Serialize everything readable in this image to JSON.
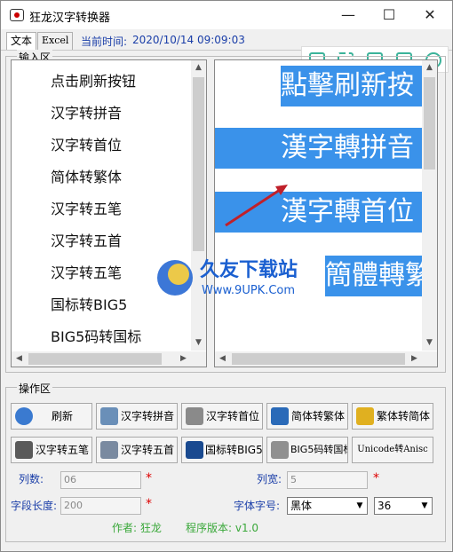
{
  "window": {
    "title": "狂龙汉字转换器"
  },
  "menubar": {
    "tabs": [
      "文本",
      "Excel"
    ],
    "time_label": "当前时间:",
    "time_value": "2020/10/14  09:09:03"
  },
  "input_group": {
    "label": "输入区",
    "items": [
      "点击刷新按钮",
      "汉字转拼音",
      "汉字转首位",
      "简体转繁体",
      "汉字转五笔",
      "汉字转五首",
      "汉字转五笔",
      "国标转BIG5",
      "BIG5码转国标"
    ]
  },
  "preview": {
    "lines": [
      "點擊刷新按",
      "漢字轉拼音",
      "漢字轉首位",
      "簡體轉繁體"
    ],
    "highlight_color": "#3a92ea"
  },
  "ops_group": {
    "label": "操作区",
    "buttons_row1": [
      "刷新",
      "汉字转拼音",
      "汉字转首位",
      "简体转繁体",
      "繁体转简体"
    ],
    "buttons_row2": [
      "汉字转五笔",
      "汉字转五首",
      "国标转BIG5",
      "BIG5码转国标",
      "Unicode转Anisc"
    ],
    "columns_label": "列数:",
    "columns_value": "06",
    "col_width_label": "列宽:",
    "col_width_value": "5",
    "field_len_label": "字段长度:",
    "field_len_value": "200",
    "font_label": "字体字号:",
    "font_name": "黑体",
    "font_size": "36",
    "required_mark": "*"
  },
  "footer": {
    "author": "作者: 狂龙",
    "version": "程序版本: v1.0"
  },
  "watermark": {
    "brand": "久友下载站",
    "url": "Www.9UPK.Com"
  },
  "icons": [
    "app-icon",
    "minimize-icon",
    "maximize-icon",
    "close-icon",
    "pin-icon",
    "fullscreen-icon",
    "save-icon",
    "share-icon",
    "settings-icon"
  ],
  "colors": {
    "accent": "#3a92ea",
    "label_blue": "#1a3ea8",
    "footer_green": "#3aa83a",
    "required_red": "#dd0000",
    "toolbar_teal": "#3bb39a"
  }
}
